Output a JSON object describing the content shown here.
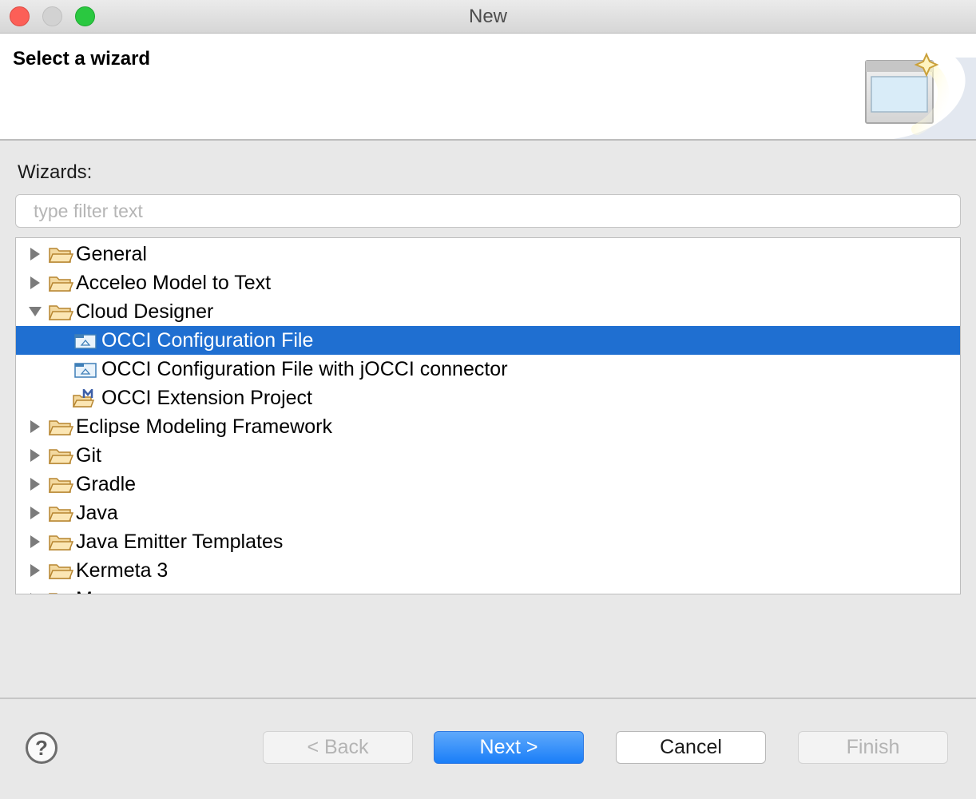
{
  "window": {
    "title": "New"
  },
  "header": {
    "title": "Select a wizard"
  },
  "wizards_label": "Wizards:",
  "filter": {
    "placeholder": "type filter text",
    "value": ""
  },
  "tree": {
    "items": [
      {
        "label": "General",
        "level": 0,
        "expandable": true,
        "expanded": false,
        "icon": "folder-icon",
        "selected": false
      },
      {
        "label": "Acceleo Model to Text",
        "level": 0,
        "expandable": true,
        "expanded": false,
        "icon": "folder-icon",
        "selected": false
      },
      {
        "label": "Cloud Designer",
        "level": 0,
        "expandable": true,
        "expanded": true,
        "icon": "folder-icon",
        "selected": false
      },
      {
        "label": "OCCI Configuration File",
        "level": 1,
        "expandable": false,
        "icon": "config-file-icon",
        "selected": true
      },
      {
        "label": "OCCI Configuration File with jOCCI connector",
        "level": 1,
        "expandable": false,
        "icon": "config-file-icon",
        "selected": false
      },
      {
        "label": "OCCI Extension Project",
        "level": 1,
        "expandable": false,
        "icon": "extension-project-icon",
        "selected": false
      },
      {
        "label": "Eclipse Modeling Framework",
        "level": 0,
        "expandable": true,
        "expanded": false,
        "icon": "folder-icon",
        "selected": false
      },
      {
        "label": "Git",
        "level": 0,
        "expandable": true,
        "expanded": false,
        "icon": "folder-icon",
        "selected": false
      },
      {
        "label": "Gradle",
        "level": 0,
        "expandable": true,
        "expanded": false,
        "icon": "folder-icon",
        "selected": false
      },
      {
        "label": "Java",
        "level": 0,
        "expandable": true,
        "expanded": false,
        "icon": "folder-icon",
        "selected": false
      },
      {
        "label": "Java Emitter Templates",
        "level": 0,
        "expandable": true,
        "expanded": false,
        "icon": "folder-icon",
        "selected": false
      },
      {
        "label": "Kermeta 3",
        "level": 0,
        "expandable": true,
        "expanded": false,
        "icon": "folder-icon",
        "selected": false
      },
      {
        "label": "M...",
        "level": 0,
        "expandable": true,
        "expanded": false,
        "icon": "folder-icon",
        "selected": false
      }
    ]
  },
  "buttons": {
    "help_icon": "help-icon",
    "back": {
      "label": "< Back",
      "enabled": false
    },
    "next": {
      "label": "Next >",
      "enabled": true,
      "default": true
    },
    "cancel": {
      "label": "Cancel",
      "enabled": true
    },
    "finish": {
      "label": "Finish",
      "enabled": false
    }
  },
  "colors": {
    "selection": "#1f6fd1",
    "primary_button": "#1a7ef8",
    "folder": "#e8b55a",
    "window_background": "#e8e8e8"
  }
}
